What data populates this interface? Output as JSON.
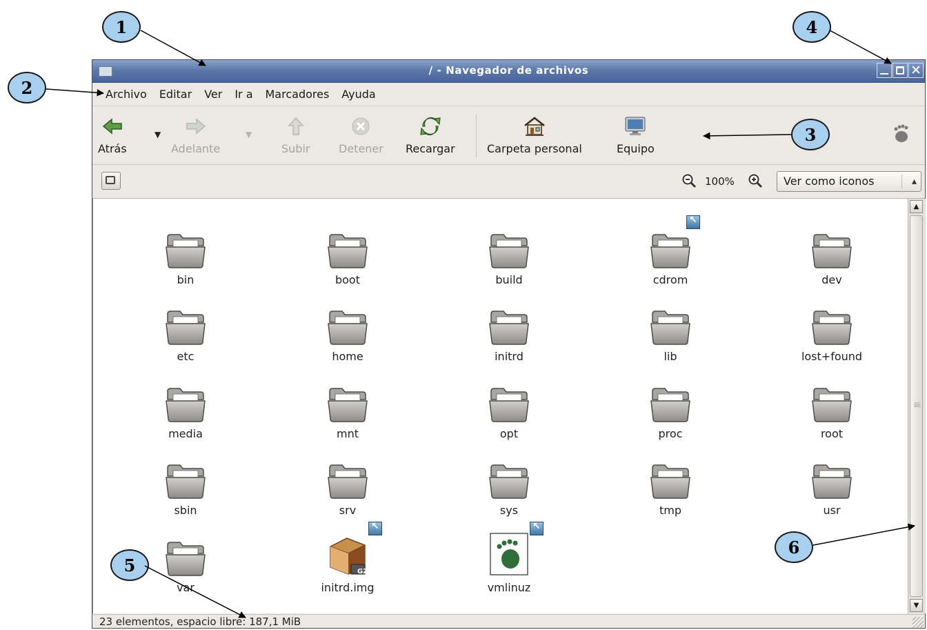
{
  "window": {
    "title": "/ - Navegador de archivos",
    "controls": {
      "minimize": "minimize-icon",
      "maximize": "maximize-icon",
      "close": "✕"
    }
  },
  "menubar": {
    "items": [
      {
        "label": "Archivo"
      },
      {
        "label": "Editar"
      },
      {
        "label": "Ver"
      },
      {
        "label": "Ir a"
      },
      {
        "label": "Marcadores"
      },
      {
        "label": "Ayuda"
      }
    ]
  },
  "toolbar": {
    "back": "Atrás",
    "forward": "Adelante",
    "up": "Subir",
    "stop": "Detener",
    "reload": "Recargar",
    "home": "Carpeta personal",
    "computer": "Equipo"
  },
  "locationbar": {
    "zoom_level": "100%",
    "view_mode": "Ver como iconos"
  },
  "files": [
    {
      "name": "bin",
      "type": "folder"
    },
    {
      "name": "boot",
      "type": "folder"
    },
    {
      "name": "build",
      "type": "folder"
    },
    {
      "name": "cdrom",
      "type": "folder",
      "link": true
    },
    {
      "name": "dev",
      "type": "folder"
    },
    {
      "name": "etc",
      "type": "folder"
    },
    {
      "name": "home",
      "type": "folder"
    },
    {
      "name": "initrd",
      "type": "folder"
    },
    {
      "name": "lib",
      "type": "folder"
    },
    {
      "name": "lost+found",
      "type": "folder"
    },
    {
      "name": "media",
      "type": "folder"
    },
    {
      "name": "mnt",
      "type": "folder"
    },
    {
      "name": "opt",
      "type": "folder"
    },
    {
      "name": "proc",
      "type": "folder"
    },
    {
      "name": "root",
      "type": "folder"
    },
    {
      "name": "sbin",
      "type": "folder"
    },
    {
      "name": "srv",
      "type": "folder"
    },
    {
      "name": "sys",
      "type": "folder"
    },
    {
      "name": "tmp",
      "type": "folder"
    },
    {
      "name": "usr",
      "type": "folder"
    },
    {
      "name": "var",
      "type": "folder"
    },
    {
      "name": "initrd.img",
      "type": "archive",
      "link": true,
      "badge": "GZ"
    },
    {
      "name": "vmlinuz",
      "type": "kernel",
      "link": true
    }
  ],
  "statusbar": {
    "text": "23 elementos, espacio libre: 187,1 MiB"
  },
  "callouts": [
    "1",
    "2",
    "3",
    "4",
    "5",
    "6"
  ],
  "colors": {
    "titlebar": "#5d79aa",
    "callout_fill": "#a9cfee",
    "window_bg": "#ece9e4"
  }
}
